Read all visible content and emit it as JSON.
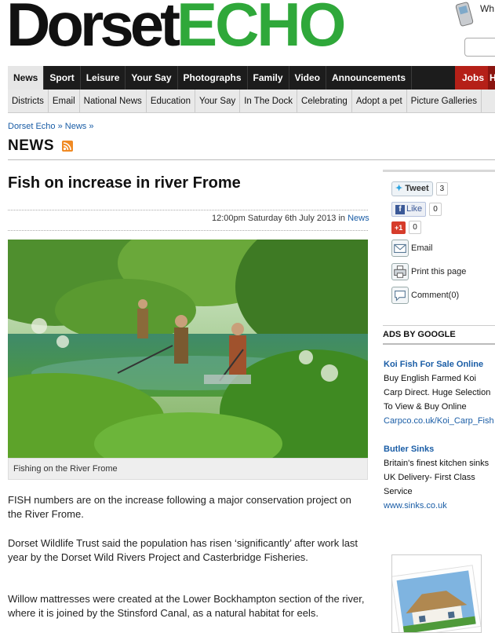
{
  "masthead": {
    "logo_part1": "Dorset",
    "logo_part2": "ECHO",
    "promo_text": "Wh"
  },
  "nav_primary": {
    "items": [
      "News",
      "Sport",
      "Leisure",
      "Your Say",
      "Photographs",
      "Family",
      "Video",
      "Announcements"
    ],
    "right_item": "Jobs",
    "tail_item": "H"
  },
  "nav_secondary": {
    "items": [
      "Districts",
      "Email",
      "National News",
      "Education",
      "Your Say",
      "In The Dock",
      "Celebrating",
      "Adopt a pet",
      "Picture Galleries"
    ]
  },
  "breadcrumb": "Dorset Echo » News »",
  "section_title": "NEWS",
  "article": {
    "headline": "Fish on increase in river Frome",
    "dateline": "12:00pm Saturday 6th July 2013 in",
    "category": "News",
    "caption": "Fishing on the River Frome",
    "paragraphs": [
      "FISH numbers are on the increase following a major conservation project on the River Frome.",
      "Dorset Wildlife Trust said the population has risen ‘significantly’ after work last year by the Dorset Wild Rivers Project and Casterbridge Fisheries.",
      "Willow mattresses were created at the Lower Bockhampton section of the river, where it is joined by the Stinsford Canal, as a natural habitat for eels."
    ]
  },
  "share": {
    "tweet_label": "Tweet",
    "tweet_count": "3",
    "like_label": "Like",
    "like_count": "0",
    "gplus_label": "+1",
    "gplus_count": "0",
    "email_label": "Email",
    "print_label": "Print this page",
    "comment_label": "Comment(0)"
  },
  "ads": {
    "heading": "ADS BY GOOGLE",
    "items": [
      {
        "title": "Koi Fish For Sale Online",
        "lines": [
          "Buy English Farmed Koi",
          "Carp Direct. Huge Selection",
          "To View & Buy Online"
        ],
        "url": "Carpco.co.uk/Koi_Carp_Fish"
      },
      {
        "title": "Butler Sinks",
        "lines": [
          "Britain's finest kitchen sinks",
          "UK Delivery- First Class",
          "Service"
        ],
        "url": "www.sinks.co.uk"
      }
    ]
  },
  "colors": {
    "brand_green": "#2fa83a",
    "nav_dark": "#1c1c1c",
    "jobs_red": "#b52018",
    "link_blue": "#1a5da6"
  }
}
